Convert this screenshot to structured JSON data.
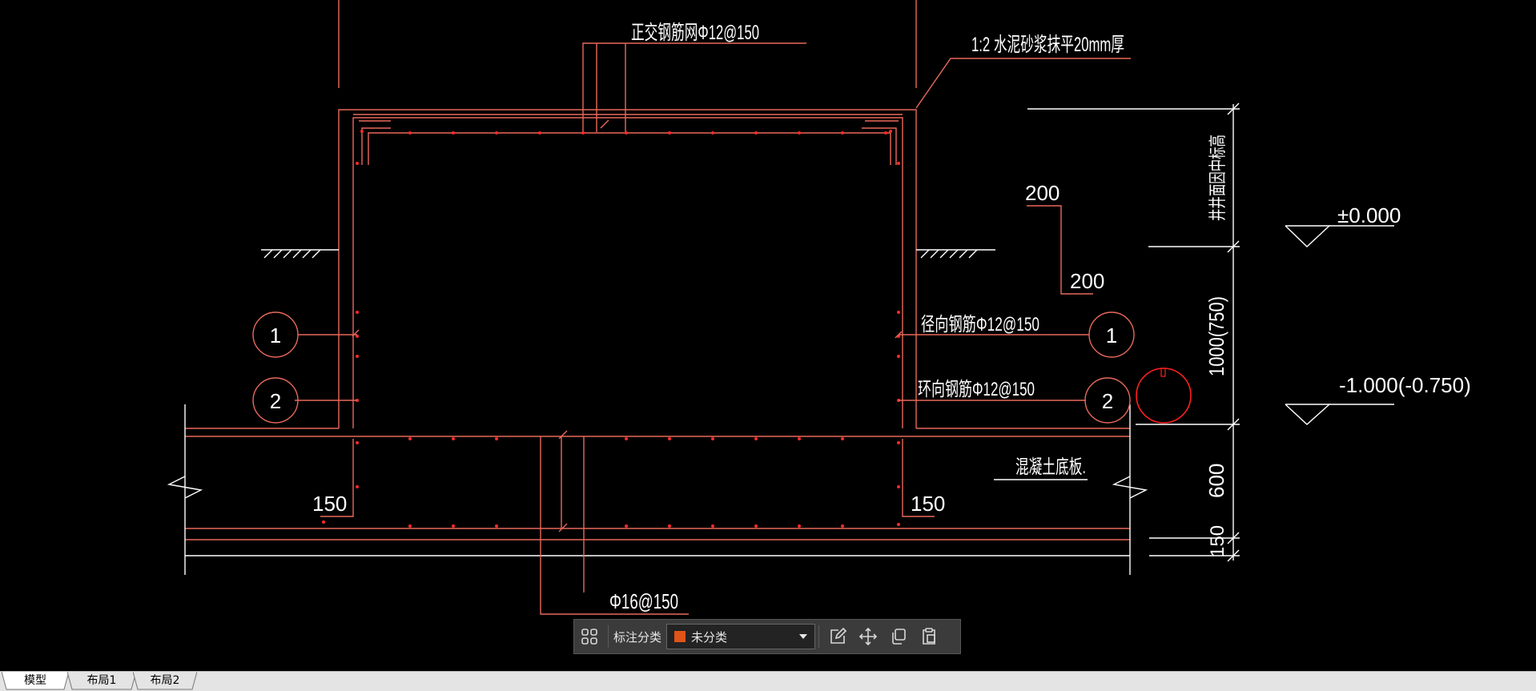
{
  "drawing": {
    "annotations": {
      "orthogonal_mesh": "正交钢筋网Φ12@150",
      "mortar_layer": "1:2 水泥砂浆抹平20mm厚",
      "radial_rebar": "径向钢筋Φ12@150",
      "hoop_rebar": "环向钢筋Φ12@150",
      "bottom_slab": "混凝土底板.",
      "bottom_rebar": "Φ16@150",
      "dim_200_a": "200",
      "dim_200_b": "200",
      "dim_150_left": "150",
      "dim_150_right": "150",
      "dim_1000": "1000(750)",
      "dim_600": "600",
      "dim_150_bottom": "150",
      "elevation_note": "井井面因中标高",
      "elev_zero": "±0.000",
      "elev_minus": "-1.000(-0.750)",
      "marker_1_left": "1",
      "marker_2_left": "2",
      "marker_1_right": "1",
      "marker_2_right": "2"
    },
    "colors": {
      "background": "#000000",
      "line": "#e8695a",
      "rebar_dot": "#ff2a2a",
      "text": "#ffffff",
      "marker_circle": "#e8695a",
      "highlight_circle": "#ff2020"
    }
  },
  "toolbar": {
    "category_label": "标注分类",
    "category_value": "未分类",
    "category_color": "#e0541a",
    "icons": [
      "grid-icon",
      "edit-icon",
      "move-icon",
      "copy-icon",
      "paste-icon"
    ]
  },
  "tabs": [
    {
      "label": "模型",
      "active": true
    },
    {
      "label": "布局1",
      "active": false
    },
    {
      "label": "布局2",
      "active": false
    }
  ]
}
